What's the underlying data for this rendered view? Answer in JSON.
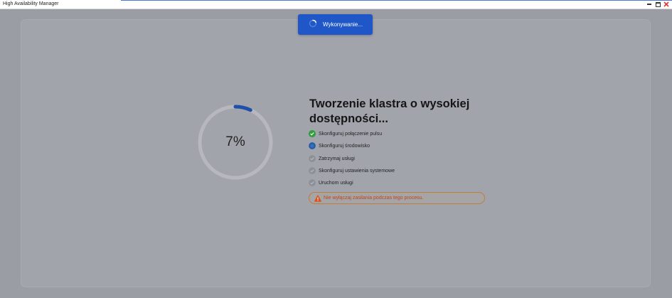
{
  "window": {
    "title": "High Availability Manager",
    "controls": [
      "minimize-icon",
      "maximize-icon",
      "close-icon"
    ]
  },
  "toast": {
    "label": "Wykonywanie...",
    "icon": "spinner-icon",
    "color": "#1f57c8"
  },
  "progress": {
    "percent_label": "7%",
    "value": 0.07,
    "ring_color": "#1f4fa8"
  },
  "heading": "Tworzenie klastra o wysokiej dostępności...",
  "steps": [
    {
      "label": "Skonfiguruj połączenie pulsu",
      "status": "done",
      "icon": "check-circle-icon"
    },
    {
      "label": "Skonfiguruj środowisko",
      "status": "active",
      "icon": "in-progress-icon"
    },
    {
      "label": "Zatrzymaj usługi",
      "status": "pending",
      "icon": "check-circle-icon"
    },
    {
      "label": "Skonfiguruj ustawienia systemowe",
      "status": "pending",
      "icon": "check-circle-icon"
    },
    {
      "label": "Uruchom usługi",
      "status": "pending",
      "icon": "check-circle-icon"
    }
  ],
  "warning": {
    "text": "Nie wyłączaj zasilania podczas tego procesu.",
    "icon": "warning-triangle-icon",
    "color": "#b9481c"
  },
  "colors": {
    "done": "#2f9e3c",
    "active": "#255ca6",
    "pending": "#8e9097"
  }
}
